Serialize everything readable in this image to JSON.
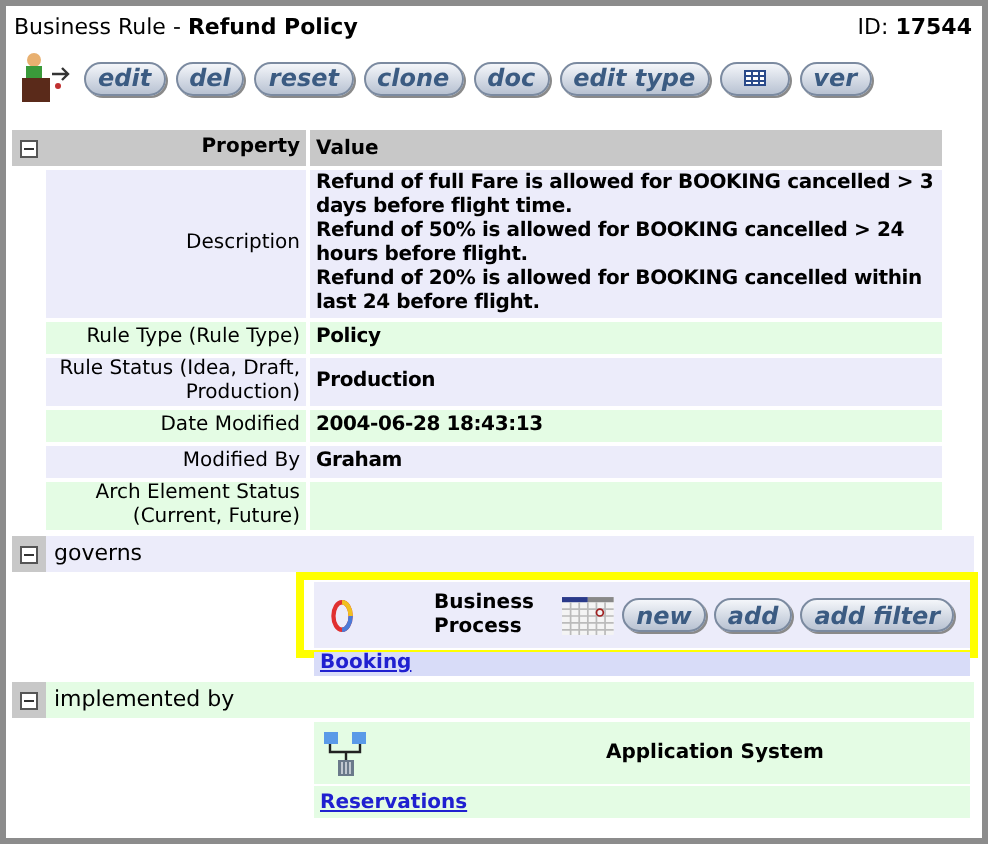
{
  "title": {
    "kind": "Business Rule",
    "separator": "-",
    "name": "Refund Policy",
    "id_label": "ID:",
    "id": "17544"
  },
  "toolbar": [
    {
      "kind": "text",
      "label": "edit"
    },
    {
      "kind": "text",
      "label": "del"
    },
    {
      "kind": "text",
      "label": "reset"
    },
    {
      "kind": "text",
      "label": "clone"
    },
    {
      "kind": "text",
      "label": "doc"
    },
    {
      "kind": "text",
      "label": "edit type"
    },
    {
      "kind": "grid"
    },
    {
      "kind": "text",
      "label": "ver"
    }
  ],
  "properties": {
    "expanded": true,
    "columns": [
      "Property",
      "Value"
    ],
    "rows": [
      {
        "property": "Description",
        "value": [
          "Refund of full Fare is allowed for BOOKING cancelled > 3 days before flight time.",
          "Refund of 50% is allowed for BOOKING cancelled > 24 hours before flight.",
          "Refund of 20% is allowed for BOOKING cancelled within last 24 before flight."
        ]
      },
      {
        "property": "Rule Type (Rule Type)",
        "value": [
          "Policy"
        ]
      },
      {
        "property": "Rule Status (Idea, Draft, Production)",
        "value": [
          "Production"
        ]
      },
      {
        "property": "Date Modified",
        "value": [
          "2004-06-28 18:43:13"
        ]
      },
      {
        "property": "Modified By",
        "value": [
          "Graham"
        ]
      },
      {
        "property": "Arch Element Status (Current, Future)",
        "value": []
      }
    ]
  },
  "sections": [
    {
      "title": "governs",
      "expanded": true,
      "kind": "process",
      "highlighted": true,
      "type_name": "Business Process",
      "buttons": [
        "new",
        "add",
        "add filter"
      ],
      "links": [
        "Booking"
      ]
    },
    {
      "title": "implemented by",
      "expanded": true,
      "kind": "system",
      "highlighted": false,
      "type_name": "Application System",
      "links": [
        "Reservations"
      ]
    }
  ]
}
